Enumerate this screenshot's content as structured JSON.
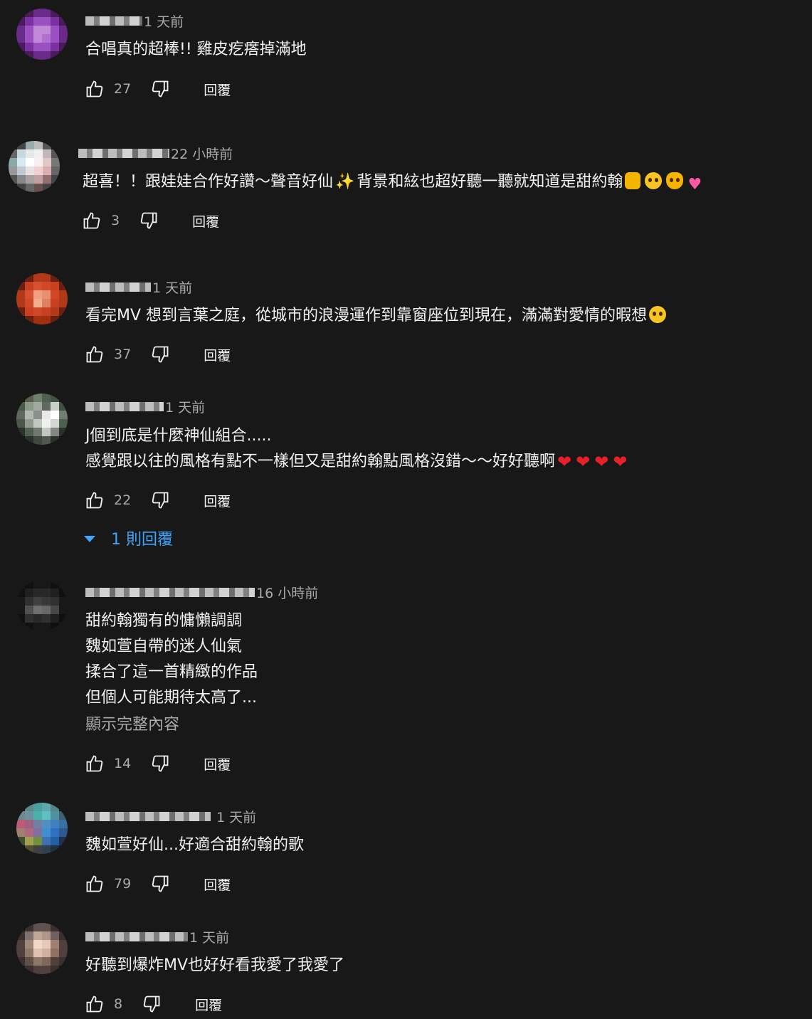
{
  "reply_label": "回覆",
  "comments": [
    {
      "time": "1 天前",
      "lines": [
        "合唱真的超棒!! 雞皮疙瘩掉滿地"
      ],
      "likes": "27",
      "avatar_colors": [
        "#1a1a1a",
        "#4a1a5a",
        "#6a2a8a",
        "#6a2a8a",
        "#4a1a5a",
        "#1a1a1a",
        "#4a1a5a",
        "#7a30a0",
        "#9a50c0",
        "#9a50c0",
        "#7a30a0",
        "#4a1a5a",
        "#6a2a8a",
        "#9a50c0",
        "#c08ad8",
        "#c08ad8",
        "#9a50c0",
        "#6a2a8a",
        "#6a2a8a",
        "#9a50c0",
        "#c08ad8",
        "#b070d0",
        "#9a50c0",
        "#6a2a8a",
        "#4a1a5a",
        "#7a30a0",
        "#9a50c0",
        "#9a50c0",
        "#7a30a0",
        "#4a1a5a",
        "#1a1a1a",
        "#4a1a5a",
        "#6a2a8a",
        "#6a2a8a",
        "#4a1a5a",
        "#1a1a1a"
      ]
    },
    {
      "time": "22 小時前",
      "lines": [
        "超喜！！跟娃娃合作好讚～聲音好仙✨背景和絃也超好聽一聽就知道是甜約翰🤟🥺😻💗"
      ],
      "likes": "3",
      "avatar_colors": [
        "#1a1a1a",
        "#444",
        "#9aa",
        "#bbb",
        "#555",
        "#1a1a1a",
        "#666",
        "#c8d8e0",
        "#e8e8e8",
        "#f0f0f0",
        "#c0b8b8",
        "#555",
        "#8aa",
        "#d8e8f0",
        "#ffffff",
        "#f8f0f0",
        "#e0c8c8",
        "#777",
        "#999",
        "#c0c8d0",
        "#e8e0e0",
        "#f0d0d0",
        "#d8b0b0",
        "#666",
        "#555",
        "#888",
        "#a8a0a0",
        "#c0a0a0",
        "#907070",
        "#444",
        "#1a1a1a",
        "#444",
        "#666",
        "#665050",
        "#444",
        "#1a1a1a"
      ]
    },
    {
      "time": "1 天前",
      "lines": [
        "看完MV 想到言葉之庭，從城市的浪漫運作到靠窗座位到現在，滿滿對愛情的暇想🧐"
      ],
      "likes": "37",
      "avatar_colors": [
        "#1a1a1a",
        "#6a2010",
        "#b03a18",
        "#b03a18",
        "#6a2010",
        "#1a1a1a",
        "#6a2010",
        "#c84020",
        "#d85030",
        "#d04828",
        "#c84020",
        "#6a2010",
        "#b03a18",
        "#d85030",
        "#f0a080",
        "#e89070",
        "#d04828",
        "#b03a18",
        "#b03a18",
        "#d04828",
        "#f0b090",
        "#e08060",
        "#c84020",
        "#b03a18",
        "#6a2010",
        "#c84020",
        "#d04828",
        "#c84020",
        "#b03a18",
        "#6a2010",
        "#1a1a1a",
        "#6a2010",
        "#a03010",
        "#a03010",
        "#6a2010",
        "#1a1a1a"
      ]
    },
    {
      "time": "1 天前",
      "lines": [
        "J個到底是什麼神仙組合.....",
        "感覺跟以往的風格有點不一樣但又是甜約翰點風格沒錯～～好好聽啊❤️❤️❤️❤️"
      ],
      "likes": "22",
      "replies_label": "1 則回覆",
      "avatar_colors": [
        "#1a1a1a",
        "#556050",
        "#708068",
        "#506050",
        "#445044",
        "#1a1a1a",
        "#4a5a4a",
        "#8a9888",
        "#a0a8a0",
        "#606860",
        "#c8d0c8",
        "#405040",
        "#606860",
        "#b0b8b0",
        "#8a908a",
        "#e8e8e8",
        "#ffffff",
        "#708070",
        "#4a584a",
        "#909890",
        "#c0c8c0",
        "#f0f0f0",
        "#d0d8d0",
        "#506050",
        "#2a302a",
        "#506050",
        "#707870",
        "#c0c8c0",
        "#808880",
        "#2a302a",
        "#1a1a1a",
        "#2a302a",
        "#404840",
        "#505850",
        "#2a302a",
        "#1a1a1a"
      ]
    },
    {
      "time": "16 小時前",
      "lines": [
        "甜約翰獨有的慵懶調調",
        "魏如萱自帶的迷人仙氣",
        "揉合了這一首精緻的作品",
        "但個人可能期待太高了..."
      ],
      "more": "顯示完整內容",
      "likes": "14",
      "avatar_colors": [
        "#1a1a1a",
        "#101010",
        "#181818",
        "#181818",
        "#101010",
        "#1a1a1a",
        "#101010",
        "#202020",
        "#282828",
        "#282828",
        "#202020",
        "#101010",
        "#181818",
        "#303030",
        "#404040",
        "#383838",
        "#303030",
        "#181818",
        "#181818",
        "#505050",
        "#707070",
        "#686868",
        "#484848",
        "#181818",
        "#101010",
        "#303030",
        "#282828",
        "#303030",
        "#202020",
        "#101010",
        "#1a1a1a",
        "#101010",
        "#181818",
        "#181818",
        "#101010",
        "#1a1a1a"
      ]
    },
    {
      "time": "1 天前",
      "lines": [
        "魏如萱好仙...好適合甜約翰的歌"
      ],
      "likes": "79",
      "avatar_colors": [
        "#1a1a1a",
        "#5a8a8a",
        "#4aa0a0",
        "#60a8b0",
        "#508888",
        "#1a1a1a",
        "#6a8a90",
        "#7090a0",
        "#4ab0a8",
        "#60c0c0",
        "#5090a0",
        "#406070",
        "#c05878",
        "#a06080",
        "#7080a0",
        "#5090c0",
        "#4080c0",
        "#3a70a0",
        "#a08070",
        "#b06880",
        "#8070a0",
        "#4090d0",
        "#3070c0",
        "#305890",
        "#405030",
        "#a0a050",
        "#709040",
        "#4070b0",
        "#2060a0",
        "#203050",
        "#1a1a1a",
        "#505030",
        "#404040",
        "#304050",
        "#203040",
        "#1a1a1a"
      ]
    },
    {
      "time": "1 天前",
      "lines": [
        "好聽到爆炸MV也好好看我愛了我愛了"
      ],
      "likes": "8",
      "avatar_colors": [
        "#1a1a1a",
        "#3a3030",
        "#605050",
        "#605050",
        "#3a3030",
        "#1a1a1a",
        "#3a3030",
        "#807070",
        "#c0a898",
        "#b09888",
        "#706060",
        "#3a3030",
        "#504040",
        "#a08878",
        "#f0d8c8",
        "#e8c8b8",
        "#a08070",
        "#504040",
        "#504040",
        "#907868",
        "#e0c0b0",
        "#d0b0a0",
        "#907060",
        "#504040",
        "#3a3030",
        "#605048",
        "#907868",
        "#806858",
        "#504038",
        "#3a3030",
        "#1a1a1a",
        "#3a3030",
        "#504040",
        "#504040",
        "#3a3030",
        "#1a1a1a"
      ]
    }
  ]
}
